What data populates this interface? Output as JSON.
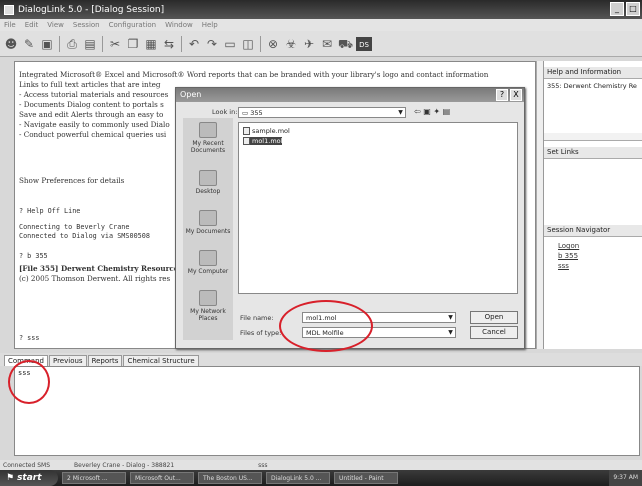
{
  "window": {
    "title": "DialogLink 5.0 - [Dialog Session]",
    "buttons": [
      "_",
      "□"
    ]
  },
  "menu": [
    "File",
    "Edit",
    "View",
    "Session",
    "Configuration",
    "Window",
    "Help"
  ],
  "toolbar_icons": [
    "people-icon",
    "pencil-icon",
    "save-icon",
    "printer-icon",
    "document-icon",
    "cut-icon",
    "copy-icon",
    "paste-icon",
    "link-icon",
    "back-icon",
    "forward-icon",
    "monitor-icon",
    "window-icon",
    "stop-icon",
    "hazard-icon",
    "tools-icon",
    "mail-icon",
    "shopping-cart-icon",
    "ds-icon"
  ],
  "main_lines": [
    {
      "text": "Integrated Microsoft® Excel and Microsoft® Word reports that can be branded with your library's logo and contact information",
      "mono": false,
      "bold": false
    },
    {
      "text": "Links to full text articles that are integ",
      "mono": false,
      "bold": false
    },
    {
      "text": "- Access tutorial materials and resources",
      "mono": false,
      "bold": false
    },
    {
      "text": "- Documents Dialog content to portals s",
      "mono": false,
      "bold": false
    },
    {
      "text": "Save and edit Alerts through an easy to",
      "mono": false,
      "bold": false
    },
    {
      "text": "- Navigate easily to commonly used Dialo",
      "mono": false,
      "bold": false
    },
    {
      "text": "- Conduct powerful chemical queries usi",
      "mono": false,
      "bold": false
    },
    {
      "text": "Show Preferences for details",
      "mono": false,
      "bold": false
    },
    {
      "text": "? Help Off Line",
      "mono": true,
      "bold": false
    },
    {
      "text": "Connecting to Beverly Crane",
      "mono": true,
      "bold": false
    },
    {
      "text": "Connected to Dialog via SMS00508",
      "mono": true,
      "bold": false
    },
    {
      "text": "? b 355",
      "mono": true,
      "bold": false
    },
    {
      "text": "[File 355] Derwent Chemistry Resource",
      "mono": false,
      "bold": true
    },
    {
      "text": "(c) 2005 Thomson Derwent. All rights res",
      "mono": false,
      "bold": false
    },
    {
      "text": "? sss",
      "mono": true,
      "bold": false
    }
  ],
  "right_panel": {
    "help_header": "Help and Information",
    "help_text": "355: Derwent Chemistry Re",
    "setlinks_header": "Set Links",
    "navigator_header": "Session Navigator",
    "nav_links": [
      "Logon",
      "b 355",
      "sss"
    ]
  },
  "tabs": [
    "Command",
    "Previous",
    "Reports",
    "Chemical Structure"
  ],
  "command_text": "sss",
  "status": [
    "Connected SMS",
    "Beverley Crane - Dialog - 388821",
    "sss"
  ],
  "taskbar": {
    "start": "start",
    "tasks": [
      "2 Microsoft ...",
      "Microsoft Out...",
      "The Boston US...",
      "DialogLink 5.0 ...",
      "Untitled - Paint"
    ],
    "clock": "9:37 AM"
  },
  "dialog": {
    "title": "Open",
    "look_in_label": "Look in:",
    "look_in_value": "355",
    "places": [
      "My Recent Documents",
      "Desktop",
      "My Documents",
      "My Computer",
      "My Network Places"
    ],
    "files": [
      "sample.mol",
      "mol1.mol"
    ],
    "file_name_label": "File name:",
    "file_name_value": "mol1.mol",
    "file_type_label": "Files of type:",
    "file_type_value": "MDL Molfile",
    "open_label": "Open",
    "cancel_label": "Cancel",
    "help_btn": "?",
    "close_btn": "X"
  },
  "annotation_color": "#d8202a"
}
